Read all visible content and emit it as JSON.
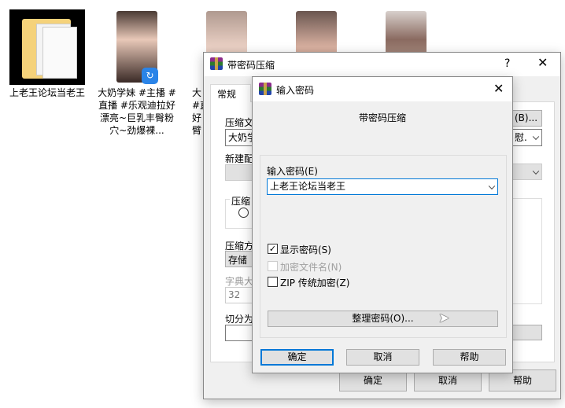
{
  "desktop": {
    "icons": [
      {
        "label": "上老王论坛当老王"
      },
      {
        "label": "大奶学妹 #主播 #直播 #乐观迪拉好漂亮~巨乳丰臀粉穴~劲爆裸..."
      }
    ],
    "partial_label_lines": [
      "大",
      "#直",
      "好",
      "臂"
    ]
  },
  "outer_dialog": {
    "title": "带密码压缩",
    "help_btn": "?",
    "tab": "常规",
    "archive_name_label": "压缩文",
    "archive_name_value": "大奶学",
    "browse_btn": "(B)...",
    "update_select": "慰.",
    "profile_label": "新建配",
    "format_group": "压缩",
    "method_label": "压缩方",
    "method_value": "存储",
    "dict_label": "字典大",
    "dict_value": "32",
    "split_label": "切分为",
    "ok": "确定",
    "cancel": "取消",
    "help": "帮助"
  },
  "password_dialog": {
    "title": "输入密码",
    "heading": "带密码压缩",
    "password_label": "输入密码(E)",
    "password_value": "上老王论坛当老王",
    "show_password": {
      "label": "显示密码(S)",
      "checked": true
    },
    "encrypt_names": {
      "label": "加密文件名(N)",
      "checked": false,
      "disabled": true
    },
    "zip_legacy": {
      "label": "ZIP 传统加密(Z)",
      "checked": false
    },
    "organize_btn": "整理密码(O)...",
    "ok": "确定",
    "cancel": "取消",
    "help": "帮助"
  }
}
